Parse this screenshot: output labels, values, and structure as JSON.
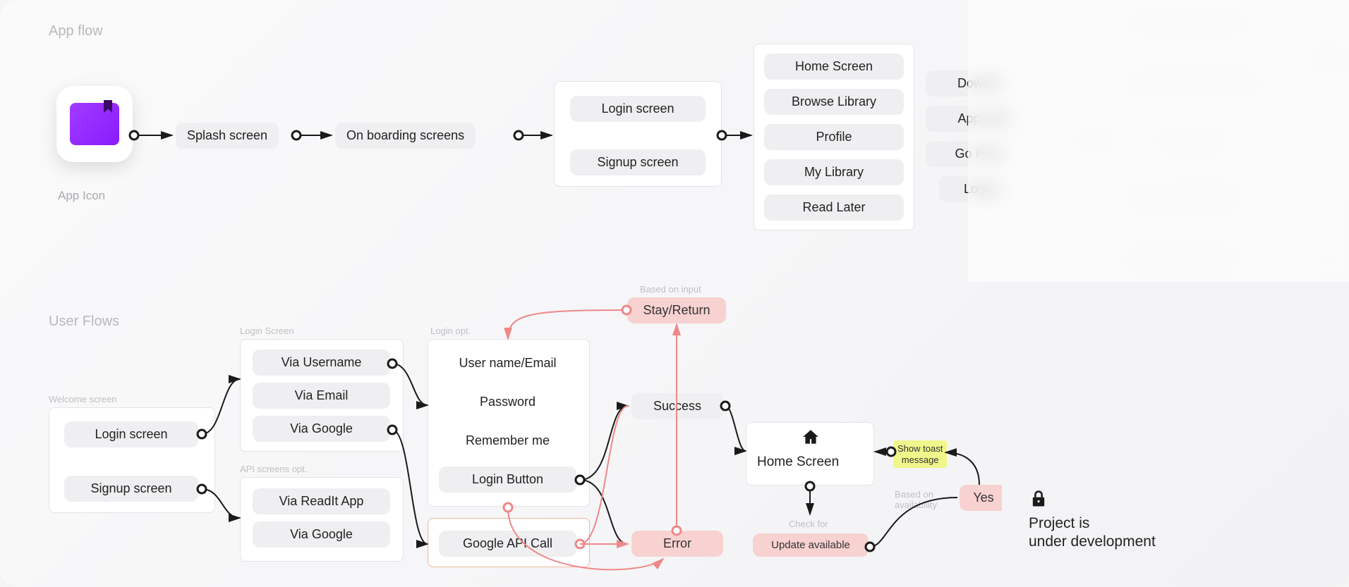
{
  "sections": {
    "app_flow": "App flow",
    "user_flows": "User Flows"
  },
  "app_icon_label": "App Icon",
  "flow": {
    "splash": "Splash screen",
    "onboarding": "On boarding screens",
    "login": "Login screen",
    "signup": "Signup screen",
    "home": "Home Screen",
    "browse": "Browse Library",
    "profile": "Profile",
    "my_library": "My Library",
    "read_later": "Read Later",
    "download": "Downlo",
    "app_settings": "App Sett",
    "go_premium": "Go Pren",
    "logout": "Logou"
  },
  "user_flow": {
    "welcome_label": "Welcome screen",
    "login_screen_label": "Login Screen",
    "api_screens_label": "API screens opt.",
    "login_opt_label": "Login opt.",
    "login_screen": "Login screen",
    "signup_screen": "Signup screen",
    "via_username": "Via Username",
    "via_email": "Via Email",
    "via_google": "Via Google",
    "via_readit": "Via ReadIt App",
    "via_google2": "Via Google",
    "username_email": "User name/Email",
    "password": "Password",
    "remember": "Remember me",
    "login_btn": "Login Button",
    "google_api": "Google API Call",
    "success": "Success",
    "error": "Error",
    "based_input": "Based on input",
    "stay_return": "Stay/Return",
    "home_screen": "Home Screen",
    "check_for": "Check for",
    "update_available": "Update available",
    "based_avail": "Based on\navailability",
    "show_toast": "Show toast\nmessage",
    "yes": "Yes"
  },
  "dev": {
    "line1": "Project is",
    "line2": "under development"
  }
}
